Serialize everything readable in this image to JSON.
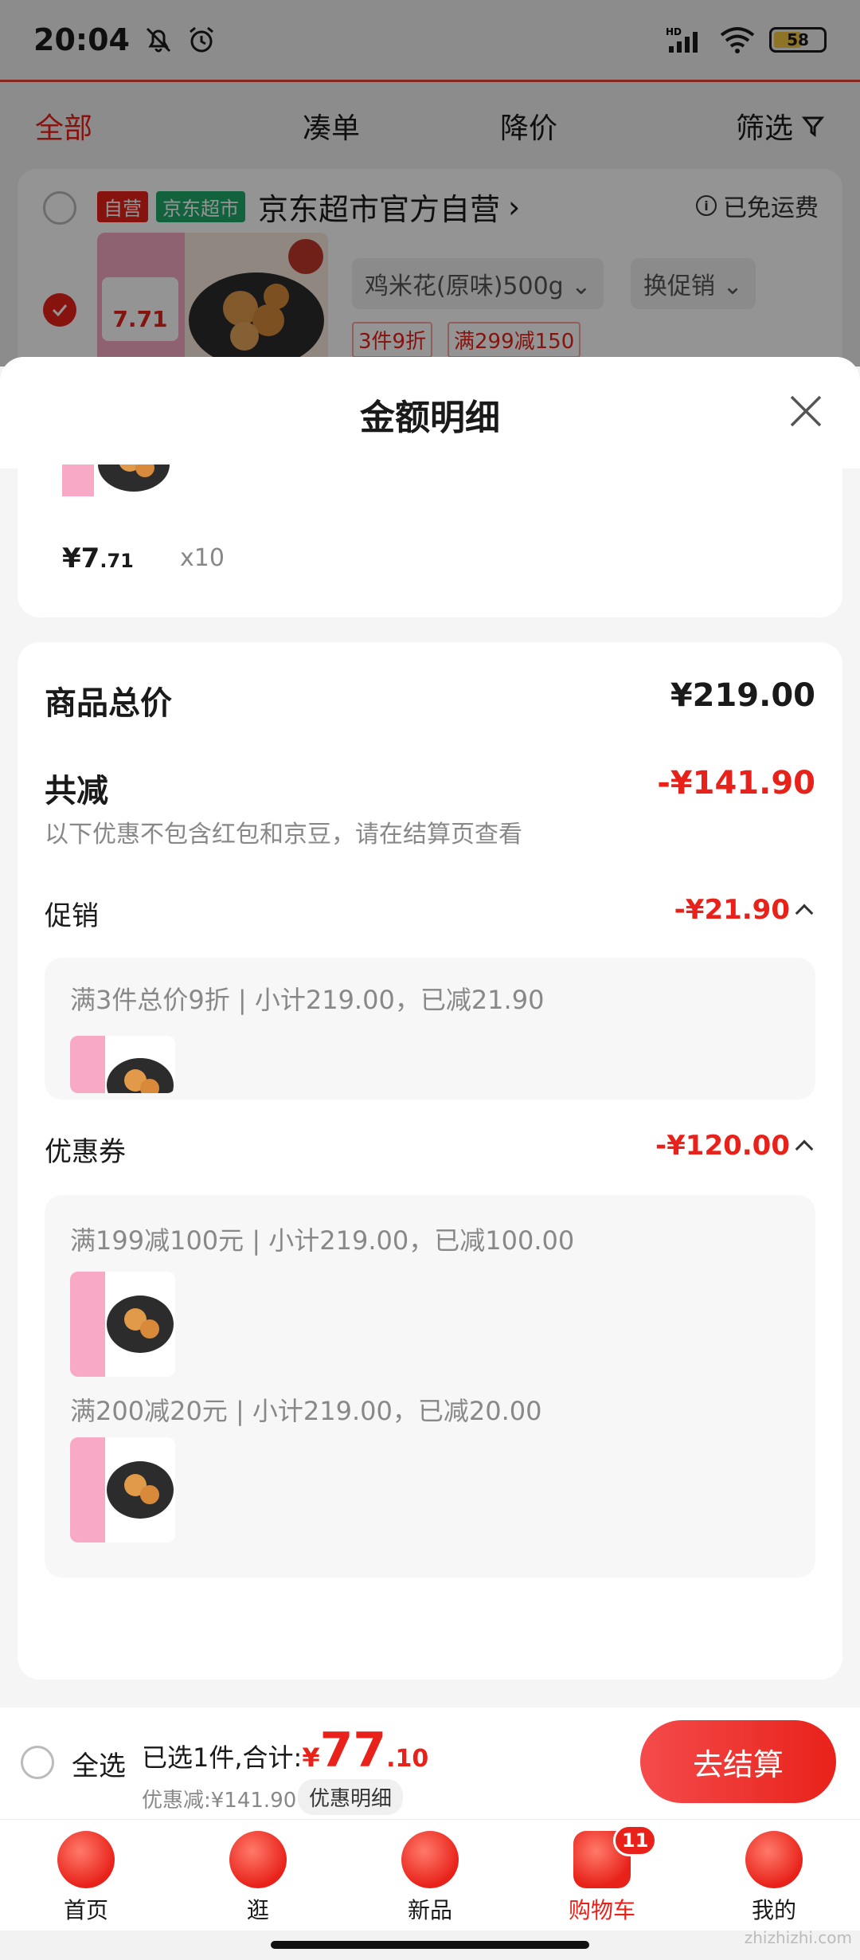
{
  "status_bar": {
    "time": "20:04",
    "battery": "58",
    "network": "HD"
  },
  "tabs": [
    "全部",
    "凑单",
    "降价",
    "筛选"
  ],
  "store": {
    "tag_self": "自营",
    "tag_market": "京东超市",
    "name": "京东超市官方自营",
    "chevron": "›",
    "free_shipping": "已免运费",
    "product_spec": "鸡米花(原味)500g",
    "promo_switch": "换促销",
    "promo_tag_1": "3件9折",
    "promo_tag_2": "满299减150"
  },
  "sheet": {
    "title": "金额明细",
    "item": {
      "price_int": "¥7",
      "price_dec": ".71",
      "qty": "x10"
    },
    "total_label": "商品总价",
    "total_value": "¥219.00",
    "reduce_label": "共减",
    "reduce_value": "-¥141.90",
    "reduce_note": "以下优惠不包含红包和京豆，请在结算页查看",
    "promo": {
      "label": "促销",
      "value": "-¥21.90",
      "line": "满3件总价9折 | 小计219.00，已减21.90"
    },
    "coupon": {
      "label": "优惠券",
      "value": "-¥120.00",
      "line1": "满199减100元 | 小计219.00，已减100.00",
      "line2": "满200减20元 | 小计219.00，已减20.00"
    }
  },
  "checkout": {
    "select_all": "全选",
    "selected": "已选1件,合计:",
    "yen": "¥",
    "total_int": "77",
    "total_dec": ".10",
    "discount": "优惠减:¥141.90",
    "detail_btn": "优惠明细",
    "checkout_btn": "去结算"
  },
  "nav": {
    "items": [
      {
        "label": "首页",
        "icon": "home-icon"
      },
      {
        "label": "逛",
        "icon": "explore-icon"
      },
      {
        "label": "新品",
        "icon": "new-products-icon"
      },
      {
        "label": "购物车",
        "icon": "cart-icon",
        "badge": "11"
      },
      {
        "label": "我的",
        "icon": "profile-icon"
      }
    ]
  },
  "watermark": "zhizhizhi.com",
  "colors": {
    "accent": "#e8221a",
    "green": "#1faa6a"
  }
}
